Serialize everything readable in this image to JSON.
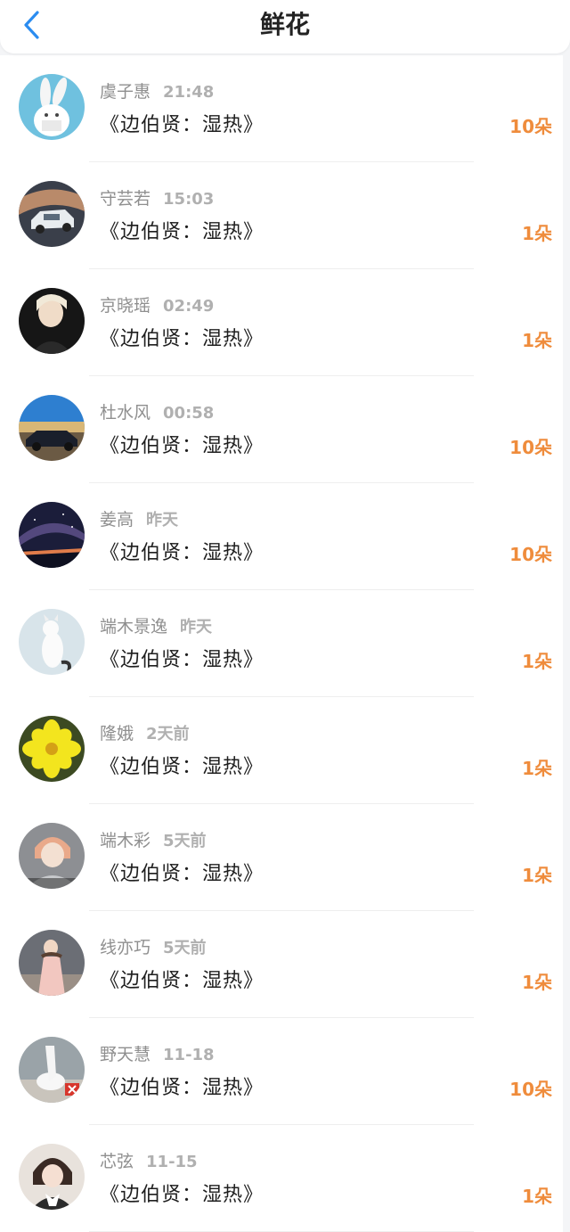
{
  "header": {
    "title": "鲜花",
    "back_icon": "chevron-left-icon",
    "accent": "#2b8cf0"
  },
  "colors": {
    "amount": "#ef8c3c",
    "name": "#8f8f8f",
    "time": "#b0b0b0"
  },
  "items": [
    {
      "name": "虞子惠",
      "time": "21:48",
      "book": "《边伯贤：湿热》",
      "amount": "10朵"
    },
    {
      "name": "守芸若",
      "time": "15:03",
      "book": "《边伯贤：湿热》",
      "amount": "1朵"
    },
    {
      "name": "京晓瑶",
      "time": "02:49",
      "book": "《边伯贤：湿热》",
      "amount": "1朵"
    },
    {
      "name": "杜水风",
      "time": "00:58",
      "book": "《边伯贤：湿热》",
      "amount": "10朵"
    },
    {
      "name": "姜高",
      "time": "昨天",
      "book": "《边伯贤：湿热》",
      "amount": "10朵"
    },
    {
      "name": "端木景逸",
      "time": "昨天",
      "book": "《边伯贤：湿热》",
      "amount": "1朵"
    },
    {
      "name": "隆娥",
      "time": "2天前",
      "book": "《边伯贤：湿热》",
      "amount": "1朵"
    },
    {
      "name": "端木彩",
      "time": "5天前",
      "book": "《边伯贤：湿热》",
      "amount": "1朵"
    },
    {
      "name": "线亦巧",
      "time": "5天前",
      "book": "《边伯贤：湿热》",
      "amount": "1朵"
    },
    {
      "name": "野天慧",
      "time": "11-18",
      "book": "《边伯贤：湿热》",
      "amount": "10朵"
    },
    {
      "name": "芯弦",
      "time": "11-15",
      "book": "《边伯贤：湿热》",
      "amount": "1朵"
    }
  ]
}
